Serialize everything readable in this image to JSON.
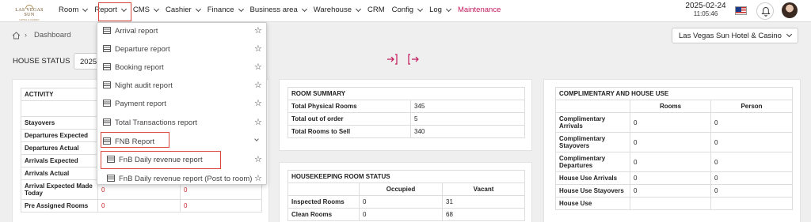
{
  "logo": {
    "line1": "LAS VEGAS SUN",
    "line2": "HOTEL & CASINO"
  },
  "nav": [
    {
      "label": "Room"
    },
    {
      "label": "Report"
    },
    {
      "label": "CMS"
    },
    {
      "label": "Cashier"
    },
    {
      "label": "Finance"
    },
    {
      "label": "Business area"
    },
    {
      "label": "Warehouse"
    },
    {
      "label": "CRM"
    },
    {
      "label": "Config"
    },
    {
      "label": "Log"
    },
    {
      "label": "Maintenance"
    }
  ],
  "header": {
    "date": "2025-02-24",
    "time": "11:05:46"
  },
  "breadcrumb": {
    "page": "Dashboard"
  },
  "hotel_select": {
    "value": "Las Vegas Sun Hotel & Casino"
  },
  "house_status": {
    "label": "HOUSE STATUS",
    "date_value": "2025"
  },
  "report_menu": [
    {
      "label": "Arrival report"
    },
    {
      "label": "Departure report"
    },
    {
      "label": "Booking report"
    },
    {
      "label": "Night audit report"
    },
    {
      "label": "Payment report"
    },
    {
      "label": "Total Transactions report"
    },
    {
      "label": "FNB Report"
    },
    {
      "label": "FnB Daily revenue report"
    },
    {
      "label": "FnB Daily revenue report (Post to room)"
    }
  ],
  "activity": {
    "title": "ACTIVITY",
    "rows": [
      {
        "label": "Stayovers",
        "a": "",
        "b": ""
      },
      {
        "label": "Departures Expected",
        "a": "",
        "b": ""
      },
      {
        "label": "Departures Actual",
        "a": "",
        "b": ""
      },
      {
        "label": "Arrivals Expected",
        "a": "",
        "b": ""
      },
      {
        "label": "Arrivals Actual",
        "a": "",
        "b": ""
      },
      {
        "label": "Arrival Expected Made Today",
        "a": "0",
        "b": "0"
      },
      {
        "label": "Pre Assigned Rooms",
        "a": "0",
        "b": "0"
      }
    ]
  },
  "room_summary": {
    "title": "ROOM SUMMARY",
    "rows": [
      {
        "label": "Total Physical Rooms",
        "value": "345"
      },
      {
        "label": "Total out of order",
        "value": "5"
      },
      {
        "label": "Total Rooms to Sell",
        "value": "340"
      }
    ]
  },
  "housekeeping": {
    "title": "HOUSEKEEPING ROOM STATUS",
    "columns": [
      "Occupied",
      "Vacant"
    ],
    "rows": [
      {
        "label": "Inspected Rooms",
        "occupied": "0",
        "vacant": "31"
      },
      {
        "label": "Clean Rooms",
        "occupied": "0",
        "vacant": "68"
      }
    ]
  },
  "complimentary": {
    "title": "COMPLIMENTARY AND HOUSE USE",
    "columns": [
      "Rooms",
      "Person"
    ],
    "rows": [
      {
        "label": "Complimentary Arrivals",
        "rooms": "0",
        "person": "0"
      },
      {
        "label": "Complimentary Stayovers",
        "rooms": "0",
        "person": "0"
      },
      {
        "label": "Complimentary Departures",
        "rooms": "0",
        "person": "0"
      },
      {
        "label": "House Use Arrivals",
        "rooms": "0",
        "person": "0"
      },
      {
        "label": "House Use Stayovers",
        "rooms": "0",
        "person": "0"
      },
      {
        "label": "House Use",
        "rooms": "",
        "person": ""
      }
    ]
  },
  "colors": {
    "accent": "#c2185b",
    "highlight_border": "#d9463c",
    "value_red": "#c62828"
  },
  "icons": [
    "home-icon",
    "chevron-right-icon",
    "check-in-icon",
    "check-out-icon",
    "bell-icon",
    "us-flag-icon",
    "list-icon",
    "star-outline-icon"
  ]
}
